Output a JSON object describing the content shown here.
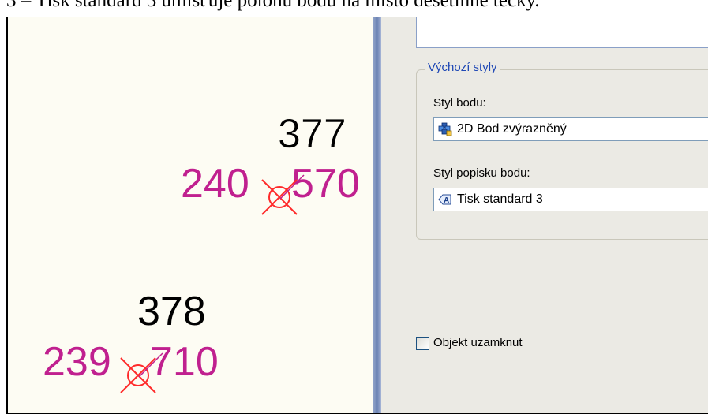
{
  "caption": "3 – Tisk standard 3 umisťuje polohu bodu na místo desetinné tečky.",
  "drawing": {
    "points": [
      {
        "number": "377",
        "height": "240.570",
        "height_left": "240",
        "height_right": "570"
      },
      {
        "number": "378",
        "height": "239.710",
        "height_left": "239",
        "height_right": "710"
      }
    ],
    "colors": {
      "number": "#000000",
      "height": "#c0208f",
      "marker": "#ff2a2a"
    }
  },
  "panel": {
    "group_title": "Výchozí styly",
    "point_style_label": "Styl bodu:",
    "point_style_value": "2D Bod zvýrazněný",
    "point_style_icon": "point-style-icon",
    "label_style_label": "Styl popisku bodu:",
    "label_style_value": "Tisk standard 3",
    "label_style_icon": "label-style-icon",
    "lock_checkbox_label": "Objekt uzamknut",
    "lock_checked": false
  }
}
